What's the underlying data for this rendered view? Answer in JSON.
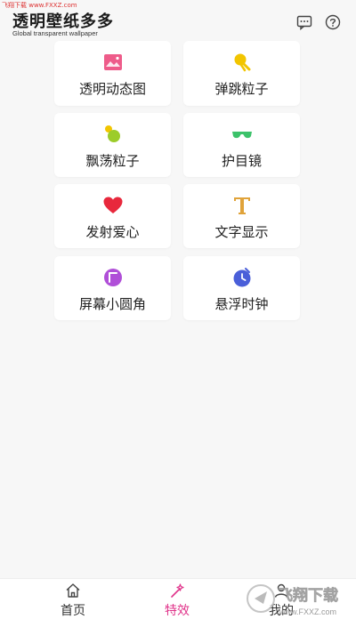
{
  "watermark": {
    "top_text": "飞翔下载 www.FXXZ.com",
    "brand_text": "飞翔下载",
    "brand_url": "www.FXXZ.com"
  },
  "header": {
    "title": "透明壁纸多多",
    "subtitle": "Global transparent wallpaper",
    "icons": [
      "message-icon",
      "help-icon"
    ]
  },
  "effects": [
    {
      "label": "透明动态图",
      "icon": "transparent-gif-icon",
      "color": "#ee5c8a"
    },
    {
      "label": "弹跳粒子",
      "icon": "bouncing-particle-icon",
      "color": "#f2c500"
    },
    {
      "label": "飘荡粒子",
      "icon": "floating-particle-icon",
      "color": "#9ccc2a"
    },
    {
      "label": "护目镜",
      "icon": "goggles-icon",
      "color": "#3cc26a"
    },
    {
      "label": "发射爱心",
      "icon": "heart-icon",
      "color": "#e8283c"
    },
    {
      "label": "文字显示",
      "icon": "text-t-icon",
      "color": "#e0a33a"
    },
    {
      "label": "屏幕小圆角",
      "icon": "rounded-corner-icon",
      "color": "#b04fd8"
    },
    {
      "label": "悬浮时钟",
      "icon": "clock-icon",
      "color": "#4a5fd9"
    }
  ],
  "tabbar": {
    "tabs": [
      {
        "label": "首页",
        "icon": "home-icon",
        "active": false
      },
      {
        "label": "特效",
        "icon": "magic-wand-icon",
        "active": true
      },
      {
        "label": "我的",
        "icon": "user-icon",
        "active": false
      }
    ],
    "active_color": "#e0338a"
  }
}
